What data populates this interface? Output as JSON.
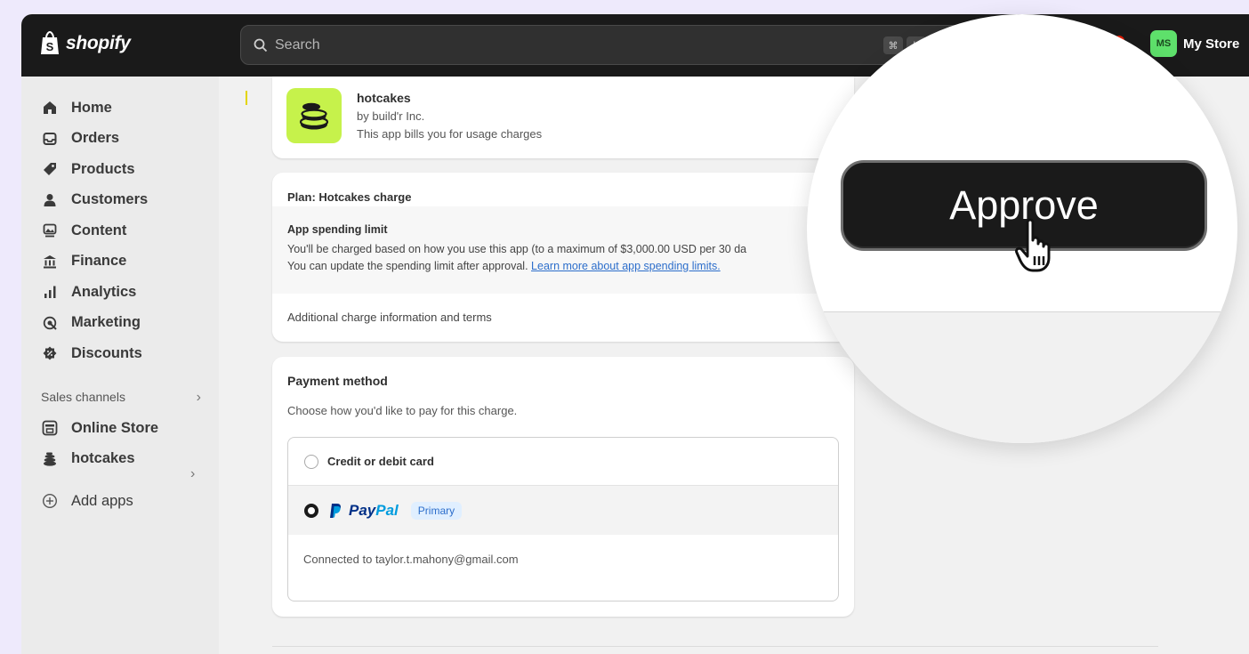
{
  "topbar": {
    "logo_text": "shopify",
    "search_placeholder": "Search",
    "kbd_1": "⌘",
    "kbd_2": "K",
    "avatar_initials": "MS",
    "store_name": "My Store"
  },
  "sidebar": {
    "items": [
      {
        "label": "Home",
        "icon": "home-icon"
      },
      {
        "label": "Orders",
        "icon": "inbox-icon"
      },
      {
        "label": "Products",
        "icon": "tag-icon"
      },
      {
        "label": "Customers",
        "icon": "person-icon"
      },
      {
        "label": "Content",
        "icon": "image-icon"
      },
      {
        "label": "Finance",
        "icon": "bank-icon"
      },
      {
        "label": "Analytics",
        "icon": "bar-chart-icon"
      },
      {
        "label": "Marketing",
        "icon": "target-icon"
      },
      {
        "label": "Discounts",
        "icon": "discount-icon"
      }
    ],
    "sales_channels_label": "Sales channels",
    "channels": [
      {
        "label": "Online Store",
        "icon": "store-icon"
      },
      {
        "label": "hotcakes",
        "icon": "hotcakes-icon"
      }
    ],
    "add_apps_label": "Add apps"
  },
  "app": {
    "name": "hotcakes",
    "by": "by build'r Inc.",
    "bills": "This app bills you for usage charges"
  },
  "plan": {
    "title": "Plan: Hotcakes charge",
    "limit_title": "App spending limit",
    "limit_line1": "You'll be charged based on how you use this app (to a maximum of $3,000.00 USD per 30 da",
    "limit_line2": "You can update the spending limit after approval.",
    "limit_link": "Learn more about app spending limits.",
    "additional": "Additional charge information and terms"
  },
  "payment": {
    "title": "Payment method",
    "subtitle": "Choose how you'd like to pay for this charge.",
    "option_card": "Credit or debit card",
    "paypal_word_1": "Pay",
    "paypal_word_2": "Pal",
    "primary_badge": "Primary",
    "connected": "Connected to taylor.t.mahony@gmail.com",
    "selected": "paypal"
  },
  "magnifier": {
    "approve_label": "Approve"
  },
  "colors": {
    "topbar": "#1a1a1a",
    "accent_green": "#c6f24b",
    "avatar": "#5ee06b",
    "link": "#2c6ecb",
    "backdrop": "#eeeafc"
  }
}
